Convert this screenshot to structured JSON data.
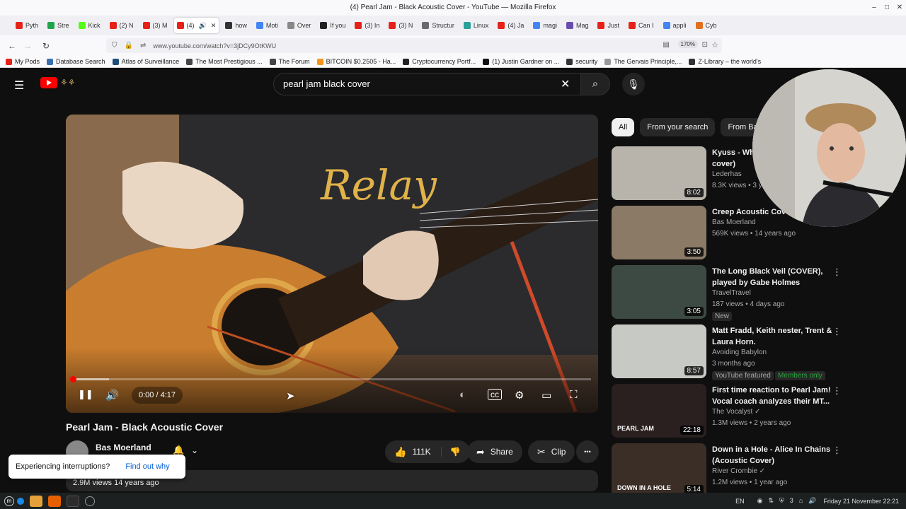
{
  "window": {
    "title": "(4) Pearl Jam - Black Acoustic Cover - YouTube — Mozilla Firefox",
    "min": "–",
    "max": "□",
    "close": "✕"
  },
  "tabs": [
    {
      "label": "Pyth",
      "color": "#e62117"
    },
    {
      "label": "Stre",
      "color": "#1ea54c"
    },
    {
      "label": "Kick",
      "color": "#53fc18"
    },
    {
      "label": "(2) N",
      "color": "#e62117"
    },
    {
      "label": "(3) M",
      "color": "#e62117"
    },
    {
      "label": "(4)",
      "color": "#e62117"
    },
    {
      "label": "how",
      "color": "#333333"
    },
    {
      "label": "Moti",
      "color": "#4285f4"
    },
    {
      "label": "Over",
      "color": "#888888"
    },
    {
      "label": "If you",
      "color": "#222222"
    },
    {
      "label": "(3) In",
      "color": "#e62117"
    },
    {
      "label": "(3) N",
      "color": "#e62117"
    },
    {
      "label": "Structur",
      "color": "#6b6b6b"
    },
    {
      "label": "Linux",
      "color": "#2aa198"
    },
    {
      "label": "(4) Ja",
      "color": "#e62117"
    },
    {
      "label": "magi",
      "color": "#4285f4"
    },
    {
      "label": "Mag",
      "color": "#6a4cb0"
    },
    {
      "label": "Just",
      "color": "#e62117"
    },
    {
      "label": "Can I",
      "color": "#e62117"
    },
    {
      "label": "appli",
      "color": "#4285f4"
    },
    {
      "label": "Cyb",
      "color": "#e07020"
    }
  ],
  "nav": {
    "back": "←",
    "forward": "→",
    "reload": "↻",
    "url": "www.youtube.com/watch?v=3jDCy9OtKWU",
    "zoom": "170%",
    "shield": "⛉",
    "lock": "🔒",
    "perm": "⇌",
    "star": "☆",
    "reader": "▤",
    "ext": "⊡"
  },
  "bookmarks": [
    {
      "label": "My Pods",
      "color": "#e62117"
    },
    {
      "label": "Database Search",
      "color": "#3a6fb0"
    },
    {
      "label": "Atlas of Surveillance",
      "color": "#1f4e79"
    },
    {
      "label": "The Most Prestigious ...",
      "color": "#444444"
    },
    {
      "label": "The Forum",
      "color": "#444444"
    },
    {
      "label": "BITCOIN $0.2505 - Ha...",
      "color": "#f7931a"
    },
    {
      "label": "Cryptocurrency Portf...",
      "color": "#222222"
    },
    {
      "label": "(1) Justin Gardner on ...",
      "color": "#111111"
    },
    {
      "label": "security",
      "color": "#333333"
    },
    {
      "label": "The Gervais Principle,...",
      "color": "#999999"
    },
    {
      "label": "Z-Library – the world's",
      "color": "#333333"
    }
  ],
  "youtube": {
    "search_query": "pearl jam black cover",
    "menu_icon": "☰",
    "clear": "✕",
    "search_glyph": "⌕",
    "mic_glyph": "🎙",
    "player": {
      "time": "0:00 / 4:17",
      "progress": 0.0,
      "buffered": 0.07,
      "play_glyph": "❚❚",
      "vol_glyph": "🔊",
      "settings_glyph": "⚙",
      "mini_glyph": "▭",
      "full_glyph": "⛶",
      "cc_glyph": "cc",
      "toggle_glyph": "◐",
      "cursor": "➤",
      "shirt_text": "Relay"
    },
    "video_title": "Pearl Jam - Black Acoustic Cover",
    "channel_name": "Bas Moerland",
    "bell": "🔔",
    "chevron": "⌄",
    "likes": "111K",
    "like_glyph": "👍",
    "dislike_glyph": "👎",
    "share": "Share",
    "share_glyph": "➦",
    "clip": "Clip",
    "clip_glyph": "✂",
    "more": "•••",
    "views": "2.9M views  14 years ago",
    "toast": {
      "text": "Experiencing interruptions?",
      "link": "Find out why"
    },
    "chips": [
      "All",
      "From your search",
      "From Bas M"
    ]
  },
  "recommendations": [
    {
      "title": "Kyuss - Whitewater (acoustic cover)",
      "channel": "Lederhas",
      "meta": "8.3K views • 3 years ago",
      "duration": "8:02",
      "bg": "#b8b4ac"
    },
    {
      "title": "Creep Acoustic Cover",
      "channel": "Bas Moerland",
      "meta": "569K views • 14 years ago",
      "duration": "3:50",
      "bg": "#8a7a66"
    },
    {
      "title": "The Long Black Veil (COVER), played by Gabe Holmes",
      "channel": "TravelTravel",
      "meta": "187 views • 4 days ago",
      "duration": "3:05",
      "badge": "New",
      "bg": "#3d4a44"
    },
    {
      "title": "Matt Fradd, Keith nester, Trent & Laura Horn.",
      "channel": "Avoiding Babylon",
      "meta": "3 months ago",
      "duration": "8:57",
      "badge": "YouTube featured",
      "badge2": "Members only",
      "bg": "#c7c9c4"
    },
    {
      "title": "First time reaction to Pearl Jam! Vocal coach analyzes their MT...",
      "channel": "The Vocalyst ✓",
      "meta": "1.3M views • 2 years ago",
      "duration": "22:18",
      "thumb_text": "PEARL JAM",
      "bg": "#2a2020"
    },
    {
      "title": "Down in a Hole - Alice In Chains (Acoustic Cover)",
      "channel": "River Crombie ✓",
      "meta": "1.2M views • 1 year ago",
      "duration": "5:14",
      "thumb_text": "DOWN IN A HOLE",
      "bg": "#3a2e26"
    }
  ],
  "taskbar": {
    "lang": "EN",
    "clock": "Friday 21 November 22:21",
    "tray_icons": [
      "◉",
      "⇅",
      "⛨",
      "3",
      "⌂",
      "🔊"
    ]
  }
}
